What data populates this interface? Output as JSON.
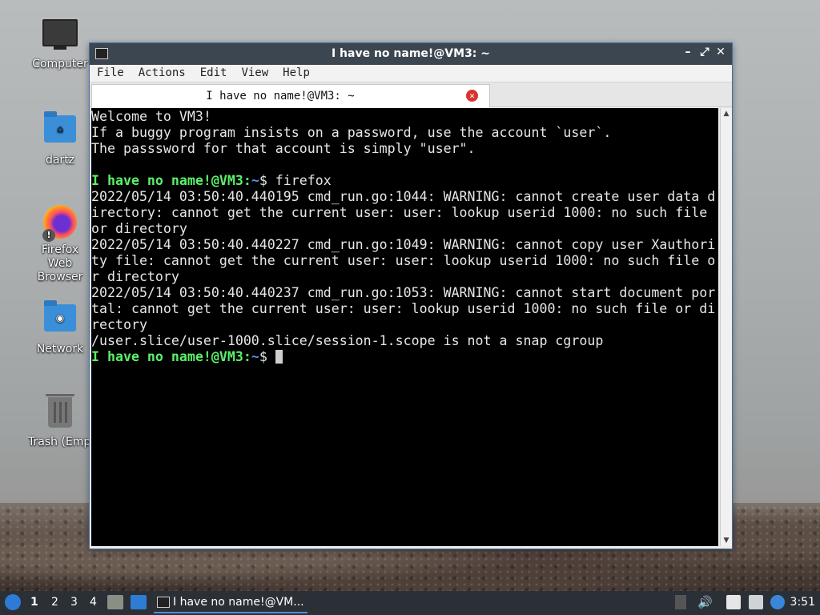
{
  "desktop": {
    "icons": [
      {
        "label": "Computer",
        "icon": "computer-icon"
      },
      {
        "label": "dartz",
        "icon": "home-folder-icon"
      },
      {
        "label": "Firefox Web Browser",
        "icon": "firefox-icon"
      },
      {
        "label": "Network",
        "icon": "network-folder-icon"
      },
      {
        "label": "Trash (Empty)",
        "icon": "trash-icon"
      }
    ]
  },
  "window": {
    "title": "I have no name!@VM3: ~",
    "controls": {
      "minimize": "–",
      "maximize": "⤢",
      "close": "✕"
    },
    "menu": [
      "File",
      "Actions",
      "Edit",
      "View",
      "Help"
    ],
    "tab": {
      "label": "I have no name!@VM3: ~"
    }
  },
  "terminal": {
    "lines": [
      {
        "text": "Welcome to VM3!"
      },
      {
        "text": "If a buggy program insists on a password, use the account `user`."
      },
      {
        "text": "The passsword for that account is simply \"user\"."
      },
      {
        "text": ""
      },
      {
        "prompt": "I have no name!@VM3",
        "cwd": "~",
        "cmd": "firefox"
      },
      {
        "text": "2022/05/14 03:50:40.440195 cmd_run.go:1044: WARNING: cannot create user data d"
      },
      {
        "text": "irectory: cannot get the current user: user: lookup userid 1000: no such file"
      },
      {
        "text": "or directory"
      },
      {
        "text": "2022/05/14 03:50:40.440227 cmd_run.go:1049: WARNING: cannot copy user Xauthori"
      },
      {
        "text": "ty file: cannot get the current user: user: lookup userid 1000: no such file o"
      },
      {
        "text": "r directory"
      },
      {
        "text": "2022/05/14 03:50:40.440237 cmd_run.go:1053: WARNING: cannot start document por"
      },
      {
        "text": "tal: cannot get the current user: user: lookup userid 1000: no such file or di"
      },
      {
        "text": "rectory"
      },
      {
        "text": "/user.slice/user-1000.slice/session-1.scope is not a snap cgroup"
      },
      {
        "prompt": "I have no name!@VM3",
        "cwd": "~",
        "cmd": "",
        "cursor": true
      }
    ],
    "prompt_color": "#5bf06a",
    "path_color": "#5b8ff0"
  },
  "taskbar": {
    "workspaces": [
      "1",
      "2",
      "3",
      "4"
    ],
    "active_task": "I have no name!@VM...",
    "clock": "3:51"
  }
}
